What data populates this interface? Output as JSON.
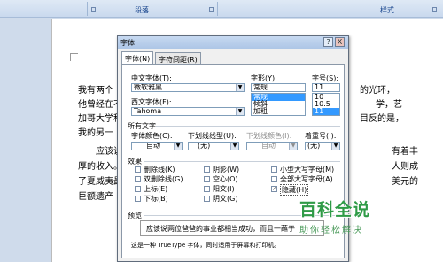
{
  "ribbon": {
    "group_paragraph": "段落",
    "group_styles": "样式"
  },
  "document": {
    "lines": [
      "我有两个",
      "他曾经在不",
      "加哥大学科",
      "我的另一",
      "应该说",
      "厚的收入。",
      "了夏威夷最",
      "巨额遗产"
    ],
    "right_fragments": [
      "的光环，",
      "学，艺",
      "目反的是，",
      "有着丰",
      "人则成",
      "美元的"
    ]
  },
  "dialog": {
    "title": "字体",
    "help": "?",
    "close": "X",
    "tabs": [
      "字体(N)",
      "字符间距(R)"
    ],
    "chinese_font_label": "中文字体(T):",
    "chinese_font_value": "微软雅黑",
    "western_font_label": "西文字体(F):",
    "western_font_value": "Tahoma",
    "style_label": "字形(Y):",
    "style_value": "常规",
    "style_options": [
      "常规",
      "倾斜",
      "加粗"
    ],
    "size_label": "字号(S):",
    "size_value": "11",
    "size_options": [
      "10",
      "10.5",
      "11"
    ],
    "all_text_label": "所有文字",
    "font_color_label": "字体颜色(C):",
    "font_color_value": "自动",
    "underline_label": "下划线线型(U):",
    "underline_value": "(无)",
    "underline_color_label": "下划线颜色(I):",
    "underline_color_value": "自动",
    "emphasis_label": "着重号(·):",
    "emphasis_value": "(无)",
    "effects_label": "效果",
    "effects": [
      {
        "label": "删除线(K)",
        "checked": false
      },
      {
        "label": "双删除线(G)",
        "checked": false
      },
      {
        "label": "上标(E)",
        "checked": false
      },
      {
        "label": "下标(B)",
        "checked": false
      },
      {
        "label": "阴影(W)",
        "checked": false
      },
      {
        "label": "空心(O)",
        "checked": false
      },
      {
        "label": "阳文(I)",
        "checked": false
      },
      {
        "label": "阴文(G)",
        "checked": false
      },
      {
        "label": "小型大写字母(M)",
        "checked": false
      },
      {
        "label": "全部大写字母(A)",
        "checked": false
      },
      {
        "label": "隐藏(H)",
        "checked": true
      }
    ],
    "preview_label": "预览",
    "preview_text": "应该说两位爸爸的事业都相当成功，而且一蘸于",
    "footer_note": "这是一种 TrueType 字体，同时适用于屏幕和打印机。"
  },
  "watermark": {
    "brand": "百科全说",
    "tagline": "助你轻松解决"
  }
}
